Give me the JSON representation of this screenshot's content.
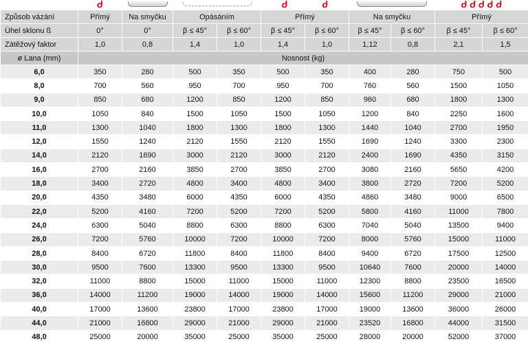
{
  "header": {
    "zpusob_label": "Způsob vázání",
    "zpusob_values": [
      "Přímý",
      "Na smyčku",
      "Opásáním",
      "Přímý",
      "Na smyčku",
      "Přímý"
    ],
    "uhel_label": "Úhel sklonu ß",
    "uhel_values": [
      "0°",
      "0°",
      "β ≤ 45°",
      "β ≤ 60°",
      "β ≤ 45°",
      "β ≤ 60°",
      "β ≤ 45°",
      "β ≤ 60°",
      "β ≤ 45°",
      "β ≤ 60°"
    ],
    "faktor_label": "Zátěžový faktor",
    "faktor_values": [
      "1,0",
      "0,8",
      "1,4",
      "1,0",
      "1,4",
      "1,0",
      "1,12",
      "0,8",
      "2,1",
      "1,5"
    ],
    "lana_label": "ø Lana (mm)",
    "nosnost_label": "Nosnost (kg)"
  },
  "icons": [
    "hook-icon",
    "sling-icon",
    "choker-icon",
    "double-hook-icon",
    "sling-icon",
    "multi-hook-icon"
  ],
  "rows": [
    {
      "d": "6,0",
      "v": [
        "350",
        "280",
        "500",
        "350",
        "500",
        "350",
        "400",
        "280",
        "750",
        "500"
      ]
    },
    {
      "d": "8,0",
      "v": [
        "700",
        "560",
        "950",
        "700",
        "950",
        "700",
        "760",
        "560",
        "1500",
        "1050"
      ]
    },
    {
      "d": "9,0",
      "v": [
        "850",
        "680",
        "1200",
        "850",
        "1200",
        "850",
        "960",
        "680",
        "1800",
        "1300"
      ]
    },
    {
      "d": "10,0",
      "v": [
        "1050",
        "840",
        "1500",
        "1050",
        "1500",
        "1050",
        "1200",
        "840",
        "2250",
        "1600"
      ]
    },
    {
      "d": "11,0",
      "v": [
        "1300",
        "1040",
        "1800",
        "1300",
        "1800",
        "1300",
        "1440",
        "1040",
        "2700",
        "1950"
      ]
    },
    {
      "d": "12,0",
      "v": [
        "1550",
        "1240",
        "2120",
        "1550",
        "2120",
        "1550",
        "1690",
        "1240",
        "3300",
        "2300"
      ]
    },
    {
      "d": "14,0",
      "v": [
        "2120",
        "1690",
        "3000",
        "2120",
        "3000",
        "2120",
        "2400",
        "1690",
        "4350",
        "3150"
      ]
    },
    {
      "d": "16,0",
      "v": [
        "2700",
        "2160",
        "3850",
        "2700",
        "3850",
        "2700",
        "3080",
        "2160",
        "5650",
        "4200"
      ]
    },
    {
      "d": "18,0",
      "v": [
        "3400",
        "2720",
        "4800",
        "3400",
        "4800",
        "3400",
        "3800",
        "2720",
        "7200",
        "5200"
      ]
    },
    {
      "d": "20,0",
      "v": [
        "4350",
        "3480",
        "6000",
        "4350",
        "6000",
        "4350",
        "4860",
        "3480",
        "9000",
        "6500"
      ]
    },
    {
      "d": "22,0",
      "v": [
        "5200",
        "4160",
        "7200",
        "5200",
        "7200",
        "5200",
        "5800",
        "4160",
        "11000",
        "7800"
      ]
    },
    {
      "d": "24,0",
      "v": [
        "6300",
        "5040",
        "8800",
        "6300",
        "8800",
        "6300",
        "7040",
        "5040",
        "13500",
        "9400"
      ]
    },
    {
      "d": "26,0",
      "v": [
        "7200",
        "5760",
        "10000",
        "7200",
        "10000",
        "7200",
        "8000",
        "5760",
        "15000",
        "11000"
      ]
    },
    {
      "d": "28,0",
      "v": [
        "8400",
        "6720",
        "11800",
        "8400",
        "11800",
        "8400",
        "9400",
        "6720",
        "17500",
        "12500"
      ]
    },
    {
      "d": "30,0",
      "v": [
        "9500",
        "7600",
        "13300",
        "9500",
        "13300",
        "9500",
        "10640",
        "7600",
        "20000",
        "14000"
      ]
    },
    {
      "d": "32,0",
      "v": [
        "11000",
        "8800",
        "15000",
        "11000",
        "15000",
        "11000",
        "12300",
        "8800",
        "23500",
        "16500"
      ]
    },
    {
      "d": "36,0",
      "v": [
        "14000",
        "11200",
        "19000",
        "14000",
        "19000",
        "14000",
        "15600",
        "11200",
        "29000",
        "21000"
      ]
    },
    {
      "d": "40,0",
      "v": [
        "17000",
        "13600",
        "23800",
        "17000",
        "23800",
        "17000",
        "19000",
        "13600",
        "36000",
        "26000"
      ]
    },
    {
      "d": "44,0",
      "v": [
        "21000",
        "16800",
        "29000",
        "21000",
        "29000",
        "21000",
        "23520",
        "16800",
        "44000",
        "31500"
      ]
    },
    {
      "d": "48,0",
      "v": [
        "25000",
        "20000",
        "35000",
        "25000",
        "35000",
        "25000",
        "28000",
        "20000",
        "52000",
        "37000"
      ]
    }
  ]
}
